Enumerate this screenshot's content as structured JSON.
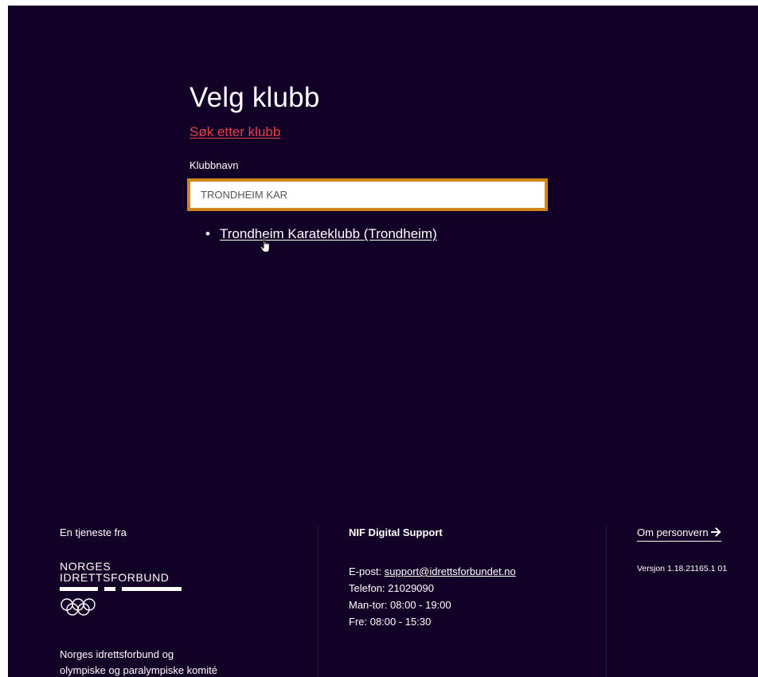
{
  "page": {
    "title": "Velg klubb",
    "search_link": "Søk etter klubb"
  },
  "search": {
    "label": "Klubbnavn",
    "value": "TRONDHEIM KAR",
    "placeholder": ""
  },
  "results": [
    {
      "label": "Trondheim Karateklubb (Trondheim)"
    }
  ],
  "footer": {
    "provider": {
      "heading": "En tjeneste fra",
      "logo_line1": "NORGES",
      "logo_line2": "IDRETTSFORBUND",
      "org_line1": "Norges idrettsforbund og",
      "org_line2": "olympiske og paralympiske komité"
    },
    "support": {
      "heading": "NIF Digital Support",
      "email_label": "E-post: ",
      "email": "support@idrettsforbundet.no",
      "phone": "Telefon: 21029090",
      "hours_weekday": "Man-tor: 08:00 - 19:00",
      "hours_friday": "Fre: 08:00 - 15:30"
    },
    "privacy": {
      "link": "Om personvern",
      "version": "Versjon 1.18.21165.1 01"
    }
  },
  "icons": {
    "arrow": "arrow-right-icon",
    "cursor": "hand-pointer-cursor-icon",
    "rings": "olympic-rings-icon"
  },
  "colors": {
    "background": "#130027",
    "accent_link": "#e5414b",
    "input_focus_border": "#d3851a",
    "text": "#ffffff"
  }
}
